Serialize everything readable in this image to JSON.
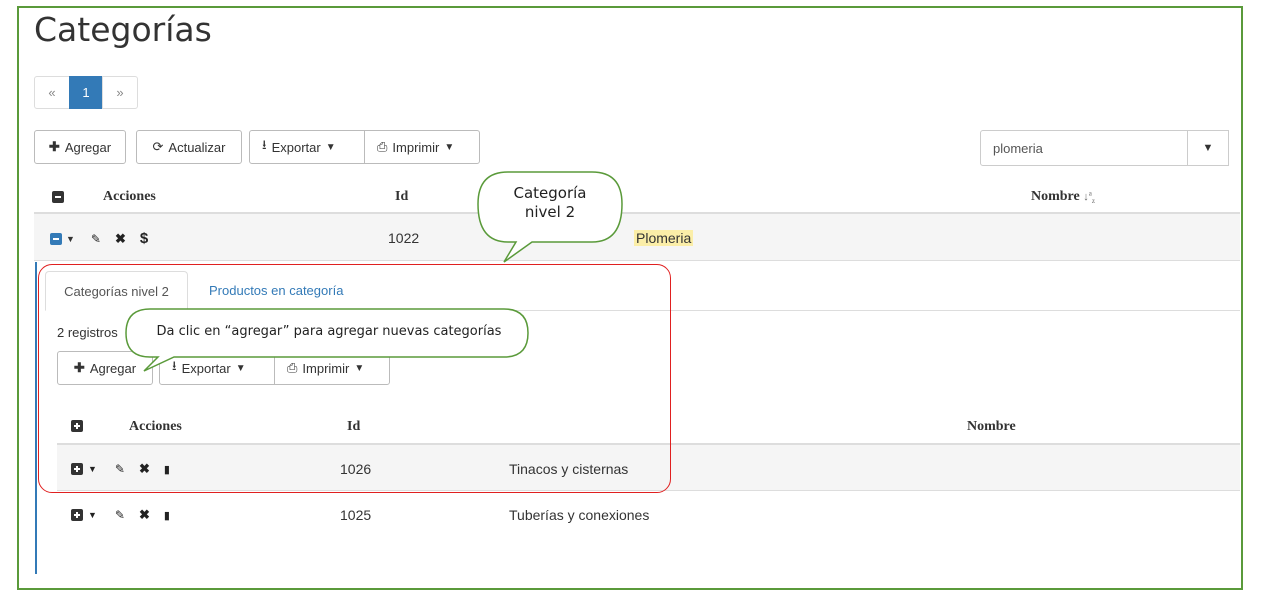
{
  "page": {
    "title": "Categorías"
  },
  "pagination": {
    "prev": "«",
    "current": "1",
    "next": "»"
  },
  "toolbar": {
    "add": "Agregar",
    "refresh": "Actualizar",
    "export": "Exportar",
    "print": "Imprimir"
  },
  "search": {
    "value": "plomeria"
  },
  "table": {
    "headers": {
      "actions": "Acciones",
      "id": "Id",
      "name": "Nombre"
    },
    "sort_glyph": "↓a/z",
    "rows": [
      {
        "id": "1022",
        "name": "Plomeria"
      }
    ]
  },
  "detail": {
    "tabs": [
      {
        "label": "Categorías nivel 2"
      },
      {
        "label": "Productos en categoría"
      }
    ],
    "count": "2 registros",
    "toolbar": {
      "add": "Agregar",
      "export": "Exportar",
      "print": "Imprimir"
    },
    "headers": {
      "actions": "Acciones",
      "id": "Id",
      "name": "Nombre"
    },
    "rows": [
      {
        "id": "1026",
        "name": "Tinacos y cisternas"
      },
      {
        "id": "1025",
        "name": "Tuberías y conexiones"
      }
    ]
  },
  "callouts": {
    "level2": "Categoría\nnivel 2",
    "hint": "Da clic en “agregar”  para agregar nuevas categorías"
  },
  "colors": {
    "accent": "#337ab7",
    "frame": "#5a9a3a",
    "highlight_box": "#e02020",
    "search_highlight": "#fbeea8"
  }
}
